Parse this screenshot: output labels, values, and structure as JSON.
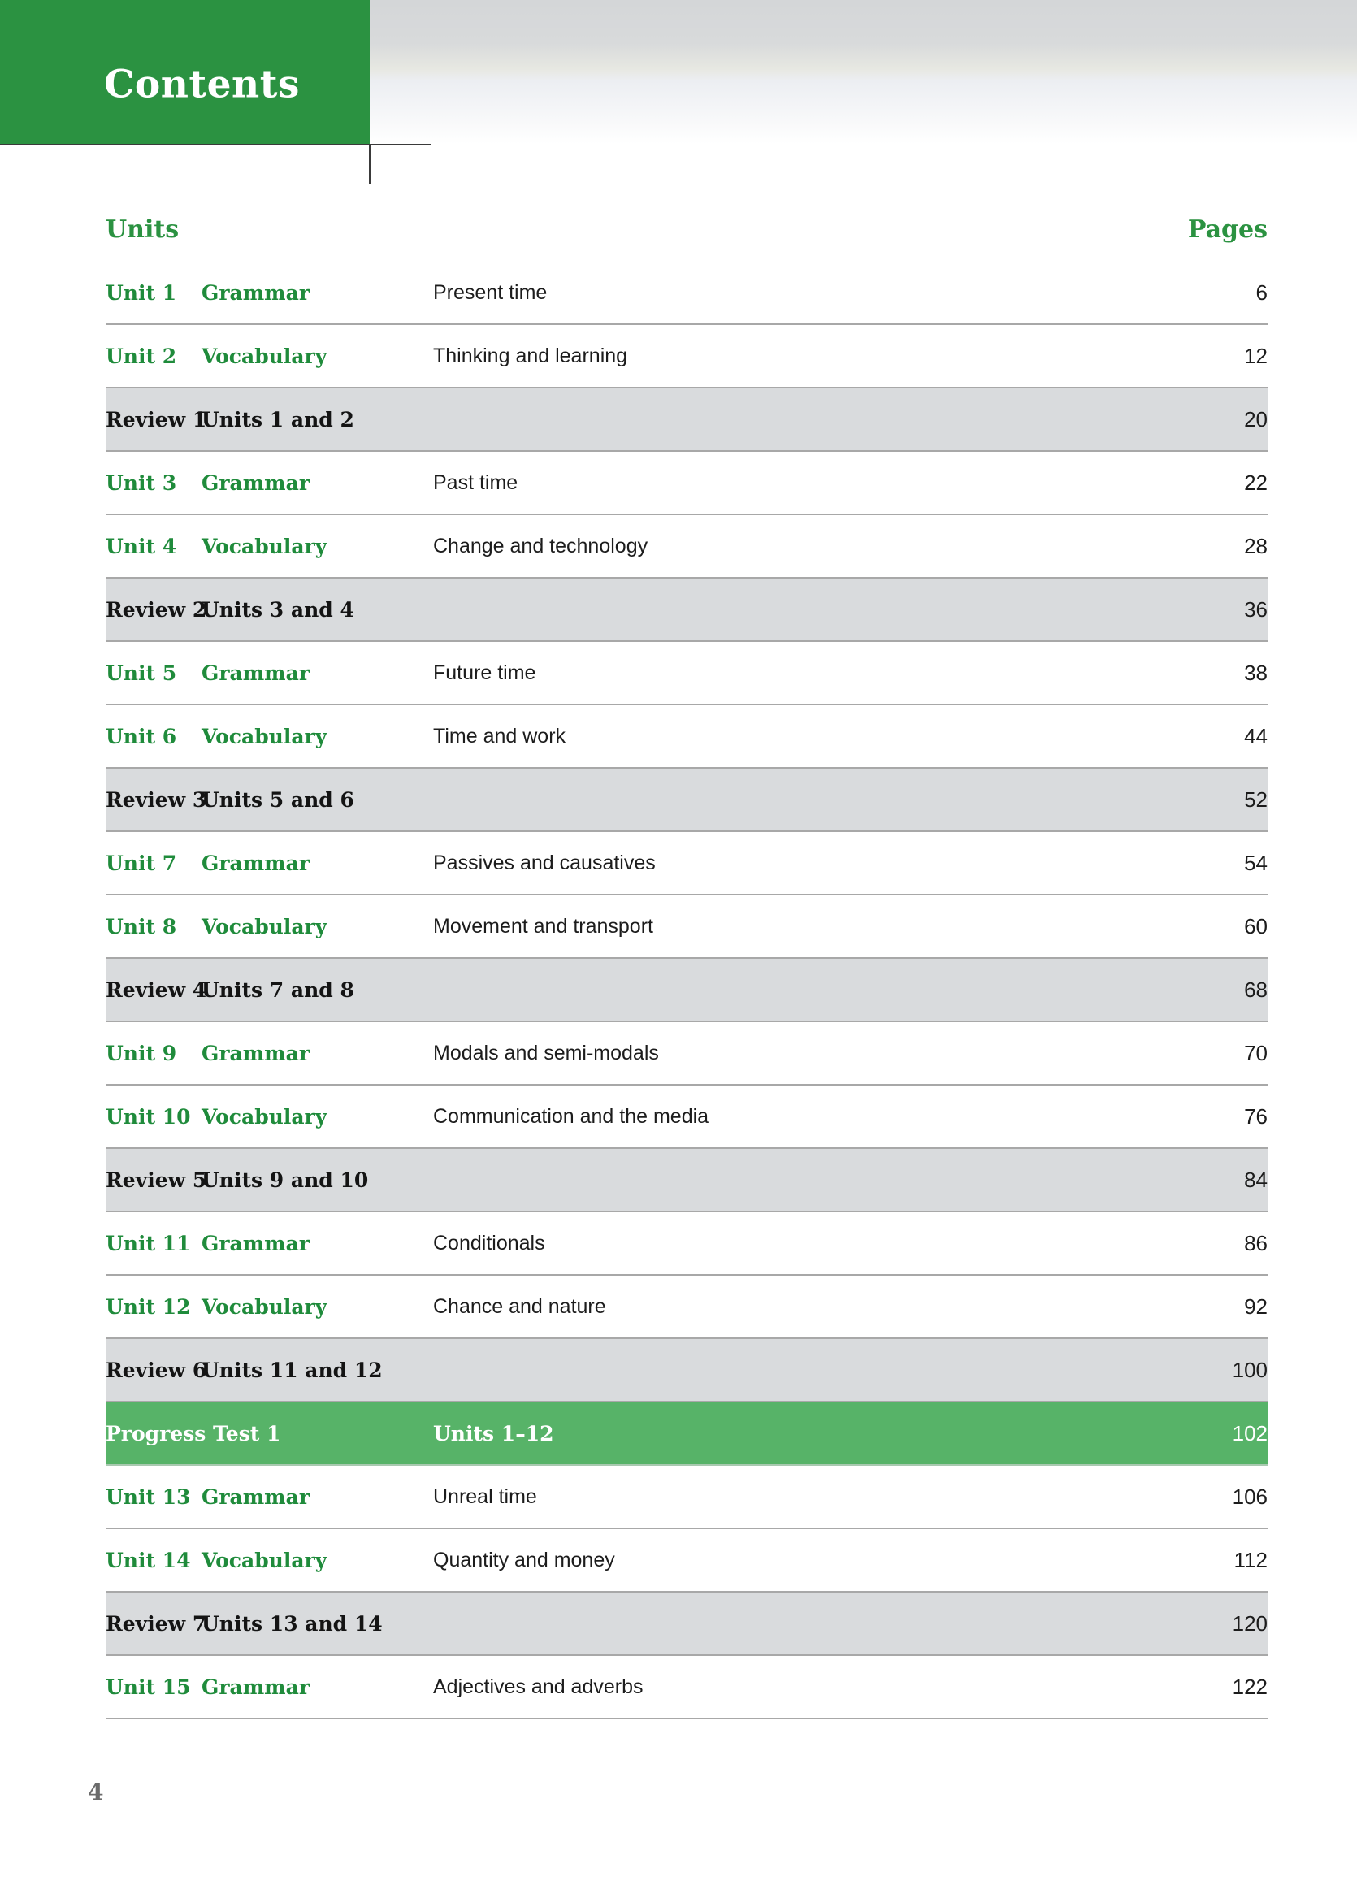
{
  "header": {
    "title": "Contents"
  },
  "table": {
    "col_units_label": "Units",
    "col_pages_label": "Pages",
    "rows": [
      {
        "type": "unit",
        "label": "Unit 1",
        "category": "Grammar",
        "description": "Present time",
        "page": "6"
      },
      {
        "type": "unit",
        "label": "Unit 2",
        "category": "Vocabulary",
        "description": "Thinking and learning",
        "page": "12"
      },
      {
        "type": "review",
        "label": "Review 1",
        "category": "",
        "description": "Units 1 and 2",
        "page": "20"
      },
      {
        "type": "unit",
        "label": "Unit 3",
        "category": "Grammar",
        "description": "Past time",
        "page": "22"
      },
      {
        "type": "unit",
        "label": "Unit 4",
        "category": "Vocabulary",
        "description": "Change and technology",
        "page": "28"
      },
      {
        "type": "review",
        "label": "Review 2",
        "category": "",
        "description": "Units 3 and 4",
        "page": "36"
      },
      {
        "type": "unit",
        "label": "Unit 5",
        "category": "Grammar",
        "description": "Future time",
        "page": "38"
      },
      {
        "type": "unit",
        "label": "Unit 6",
        "category": "Vocabulary",
        "description": "Time and work",
        "page": "44"
      },
      {
        "type": "review",
        "label": "Review 3",
        "category": "",
        "description": "Units 5 and 6",
        "page": "52"
      },
      {
        "type": "unit",
        "label": "Unit 7",
        "category": "Grammar",
        "description": "Passives and causatives",
        "page": "54"
      },
      {
        "type": "unit",
        "label": "Unit 8",
        "category": "Vocabulary",
        "description": "Movement and transport",
        "page": "60"
      },
      {
        "type": "review",
        "label": "Review 4",
        "category": "",
        "description": "Units 7 and 8",
        "page": "68"
      },
      {
        "type": "unit",
        "label": "Unit 9",
        "category": "Grammar",
        "description": "Modals and semi-modals",
        "page": "70"
      },
      {
        "type": "unit",
        "label": "Unit 10",
        "category": "Vocabulary",
        "description": "Communication and the media",
        "page": "76"
      },
      {
        "type": "review",
        "label": "Review 5",
        "category": "",
        "description": "Units 9 and 10",
        "page": "84"
      },
      {
        "type": "unit",
        "label": "Unit 11",
        "category": "Grammar",
        "description": "Conditionals",
        "page": "86"
      },
      {
        "type": "unit",
        "label": "Unit 12",
        "category": "Vocabulary",
        "description": "Chance and nature",
        "page": "92"
      },
      {
        "type": "review",
        "label": "Review 6",
        "category": "",
        "description": "Units 11 and 12",
        "page": "100"
      },
      {
        "type": "test",
        "label": "Progress Test 1",
        "category": "",
        "description": "Units 1–12",
        "page": "102"
      },
      {
        "type": "unit",
        "label": "Unit 13",
        "category": "Grammar",
        "description": "Unreal time",
        "page": "106"
      },
      {
        "type": "unit",
        "label": "Unit 14",
        "category": "Vocabulary",
        "description": "Quantity and money",
        "page": "112"
      },
      {
        "type": "review",
        "label": "Review 7",
        "category": "",
        "description": "Units 13 and 14",
        "page": "120"
      },
      {
        "type": "unit",
        "label": "Unit 15",
        "category": "Grammar",
        "description": "Adjectives and adverbs",
        "page": "122"
      }
    ]
  },
  "footer": {
    "folio": "4"
  },
  "colors": {
    "banner_green": "#2b9241",
    "unit_green": "#1f8b3b",
    "review_grey": "#d9dbdd",
    "test_green": "#57b368",
    "rule_grey": "#a8a8a8",
    "folio_grey": "#6b6b6b"
  }
}
